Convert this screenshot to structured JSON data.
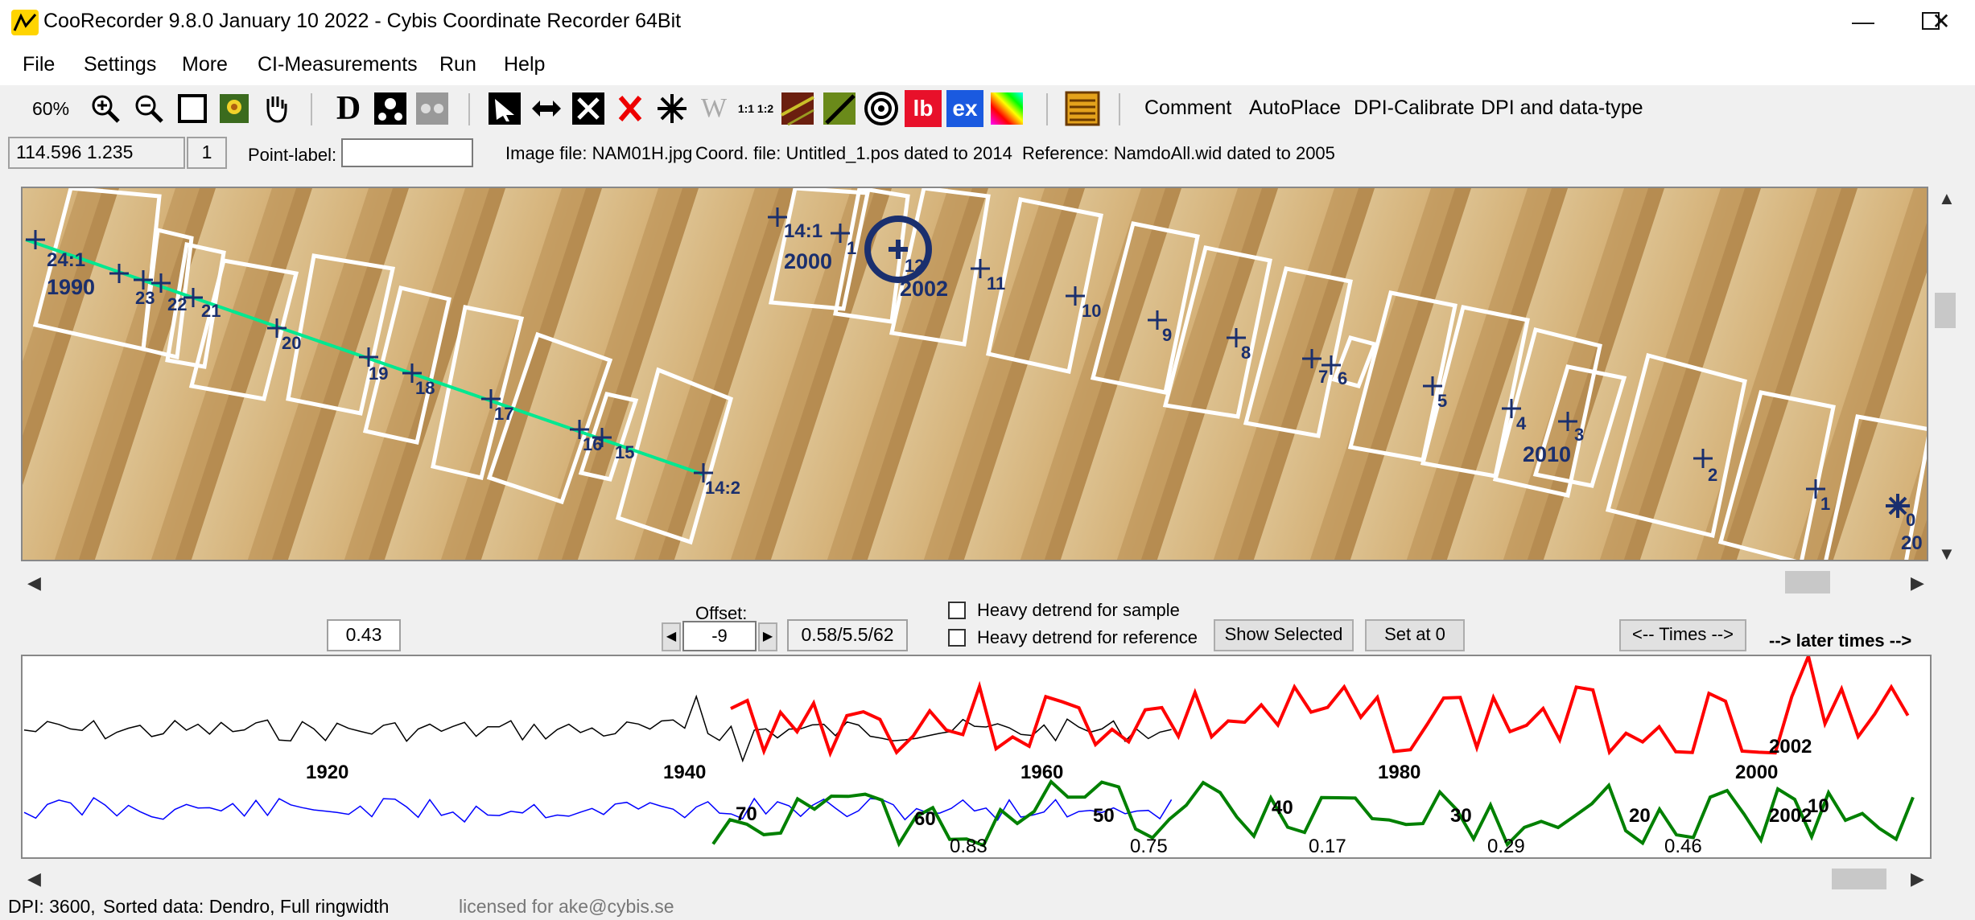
{
  "window": {
    "title": "CooRecorder 9.8.0 January 10 2022 - Cybis Coordinate Recorder  64Bit",
    "minimize": "—",
    "maximize": "☐",
    "close": "✕"
  },
  "menu": [
    "File",
    "Settings",
    "More",
    "CI-Measurements",
    "Run",
    "Help"
  ],
  "toolbar": {
    "zoom": "60%",
    "d_label": "D",
    "w_label": "W",
    "ratio_label": "1:1 1:2",
    "lb_label": "lb",
    "ex_label": "ex",
    "text_buttons": [
      "Comment",
      "AutoPlace",
      "DPI-Calibrate",
      "DPI and data-type"
    ]
  },
  "info": {
    "coords": "114.596  1.235",
    "count": "1",
    "point_label": "Point-label:",
    "point_label_value": "",
    "image_file": "Image file: NAM01H.jpg",
    "coord_file": "Coord. file: Untitled_1.pos dated to 2014",
    "reference": "Reference: NamdoAll.wid dated to 2005"
  },
  "image_labels": [
    {
      "text": "24:1",
      "bold": true
    },
    {
      "text": "1990",
      "bold": true
    },
    {
      "text": "23",
      "bold": true
    },
    {
      "text": "22",
      "bold": true
    },
    {
      "text": "21",
      "bold": true
    },
    {
      "text": "20",
      "bold": true
    },
    {
      "text": "19",
      "bold": true
    },
    {
      "text": "18",
      "bold": true
    },
    {
      "text": "17",
      "bold": true
    },
    {
      "text": "16",
      "bold": true
    },
    {
      "text": "15",
      "bold": true
    },
    {
      "text": "14:2",
      "bold": true
    },
    {
      "text": "14:1",
      "bold": true
    },
    {
      "text": "2000",
      "bold": true
    },
    {
      "text": "1",
      "bold": true
    },
    {
      "text": "12",
      "bold": true
    },
    {
      "text": "2002",
      "bold": true
    },
    {
      "text": "11",
      "bold": true
    },
    {
      "text": "10",
      "bold": true
    },
    {
      "text": "9",
      "bold": true
    },
    {
      "text": "8",
      "bold": true
    },
    {
      "text": "7",
      "bold": true
    },
    {
      "text": "6",
      "bold": true
    },
    {
      "text": "5",
      "bold": true
    },
    {
      "text": "4",
      "bold": true
    },
    {
      "text": "3",
      "bold": true
    },
    {
      "text": "2010",
      "bold": true
    },
    {
      "text": "2",
      "bold": true
    },
    {
      "text": "1",
      "bold": true
    },
    {
      "text": "0",
      "bold": true
    },
    {
      "text": "20",
      "bold": true
    }
  ],
  "controls": {
    "correlation_value": "0.43",
    "offset_label": "Offset:",
    "offset_value": "-9",
    "stats_value": "0.58/5.5/62",
    "heavy_sample": "Heavy detrend for sample",
    "heavy_reference": "Heavy detrend for reference",
    "show_selected": "Show Selected",
    "set_at_0": "Set at 0",
    "times_button": "<-- Times -->",
    "later_times": "--> later times -->"
  },
  "graph_labels": {
    "years": [
      "1920",
      "1940",
      "1960",
      "1980",
      "2000",
      "2002",
      "2002"
    ],
    "offsets": [
      "70",
      "60",
      "50",
      "40",
      "30",
      "20",
      "10"
    ],
    "correlations": [
      "0.83",
      "0.75",
      "0.17",
      "0.29",
      "0.46"
    ]
  },
  "status": {
    "dpi": "DPI: 3600,",
    "sorted": "Sorted data: Dendro, Full ringwidth",
    "license": "licensed for ake@cybis.se"
  },
  "colors": {
    "red_series": "#ff0000",
    "green_series": "#008000",
    "blue_series": "#0000ff",
    "black_series": "#000000",
    "path_line": "#00e890",
    "marker": "#1a2f6e",
    "wood": "#d8b783"
  }
}
